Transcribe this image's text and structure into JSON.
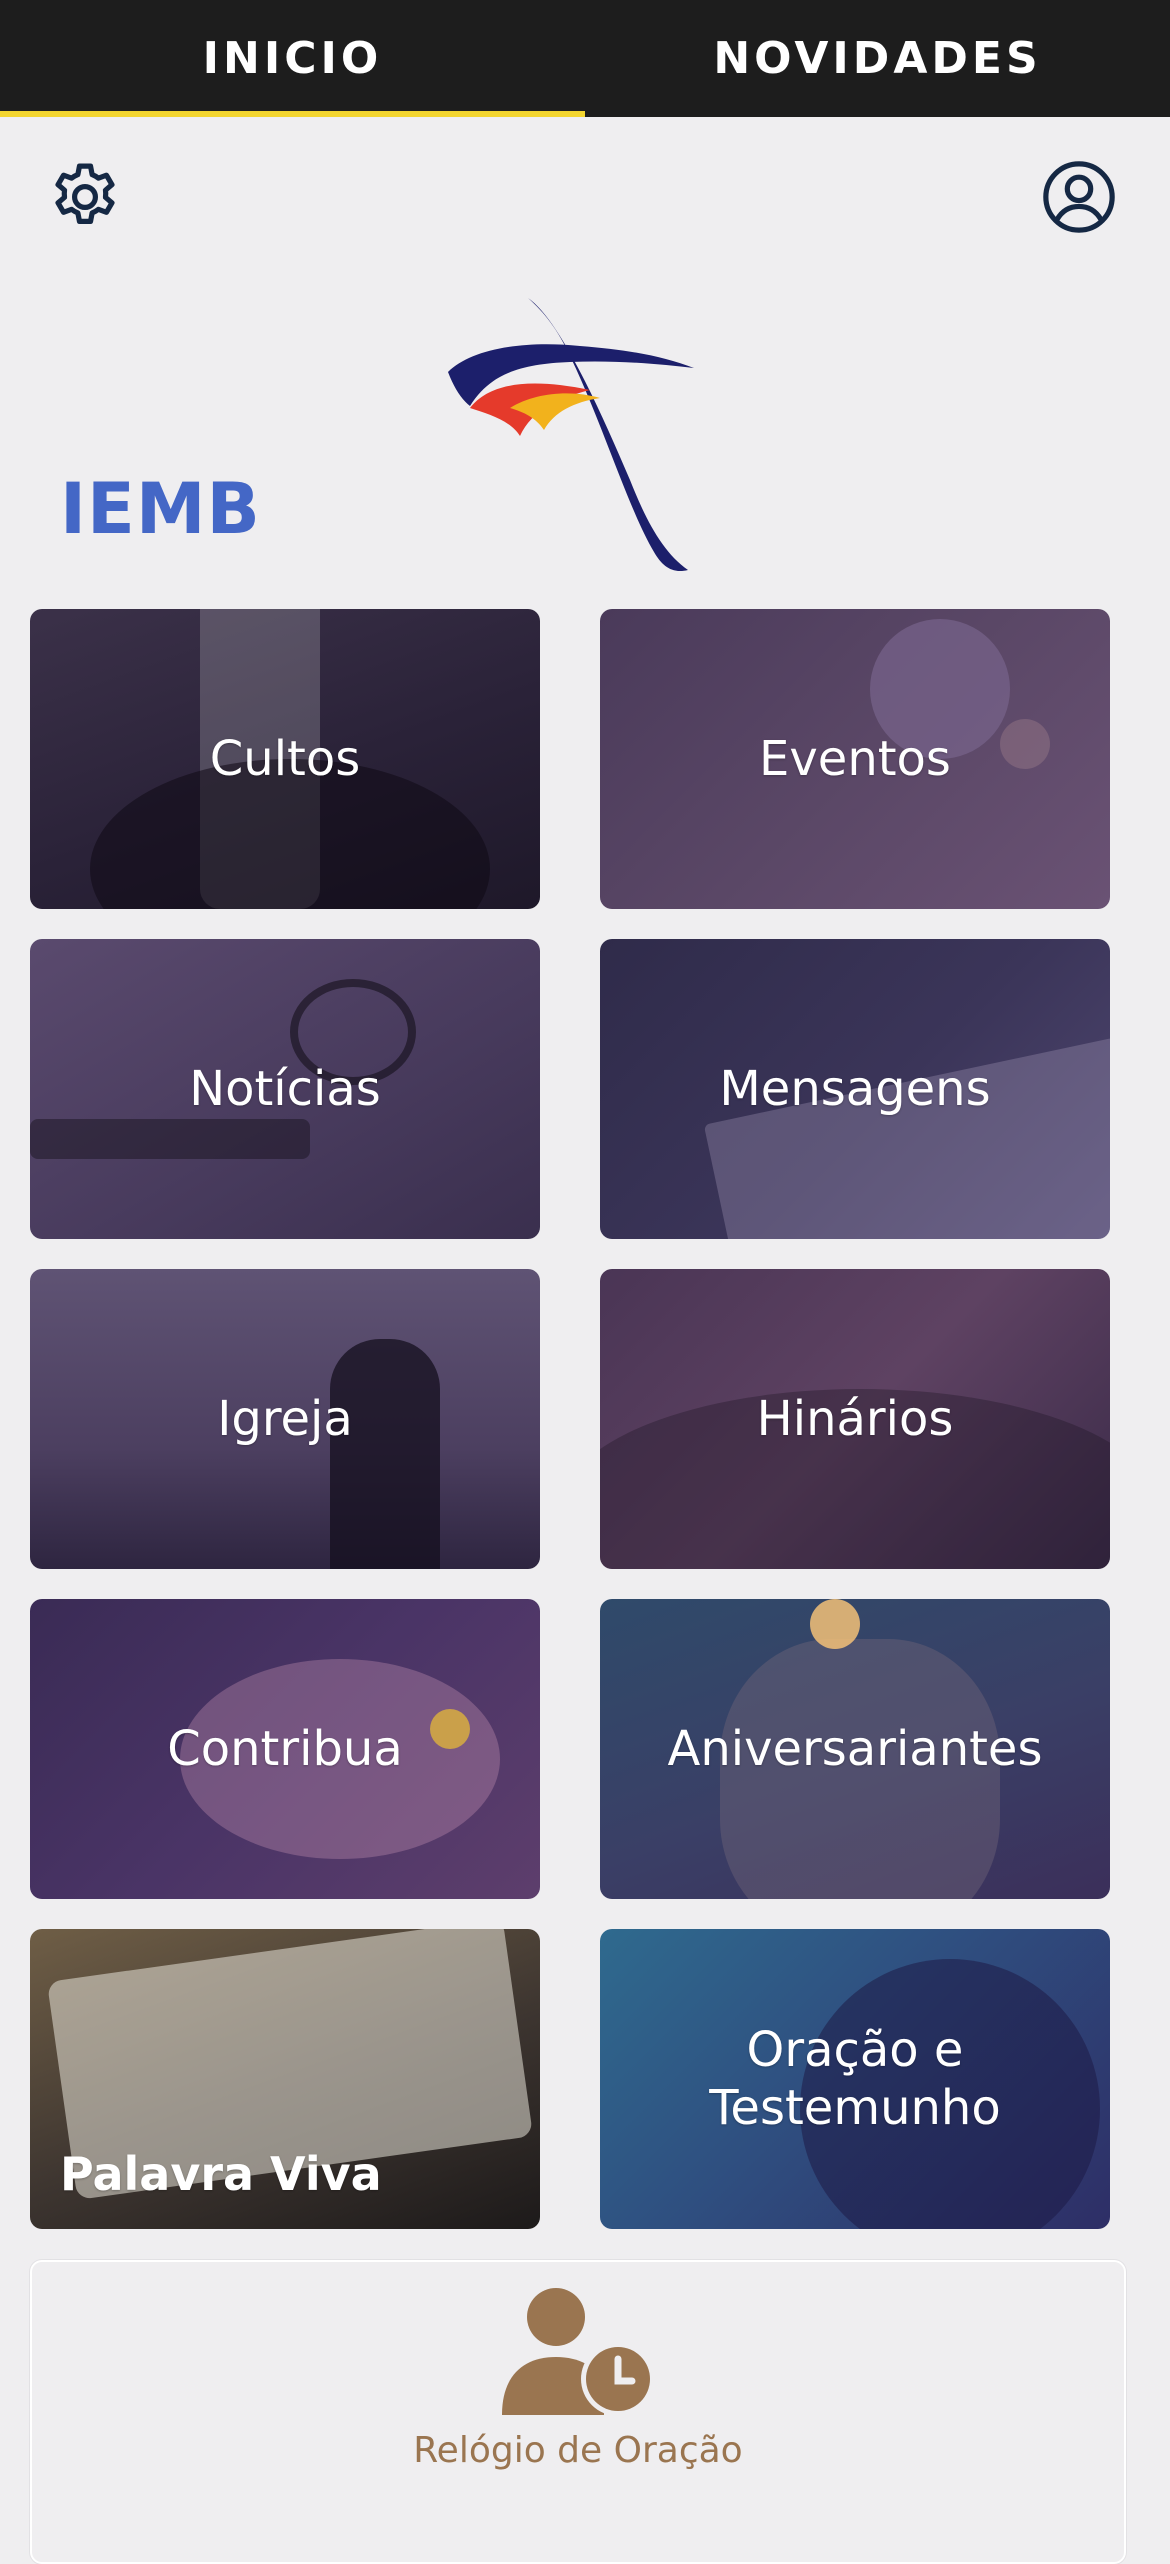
{
  "tabs": [
    {
      "label": "INICIO",
      "active": true
    },
    {
      "label": "NOVIDADES",
      "active": false
    }
  ],
  "header": {
    "settings_icon": "gear-icon",
    "profile_icon": "user-circle-icon"
  },
  "brand": {
    "name": "IEMB"
  },
  "tiles": [
    {
      "label": "Cultos"
    },
    {
      "label": "Eventos"
    },
    {
      "label": "Notícias"
    },
    {
      "label": "Mensagens"
    },
    {
      "label": "Igreja"
    },
    {
      "label": "Hinários"
    },
    {
      "label": "Contribua"
    },
    {
      "label": "Aniversariantes"
    },
    {
      "label": "Palavra Viva"
    },
    {
      "label": "Oração e Testemunho"
    }
  ],
  "prayer_clock": {
    "label": "Relógio de Oração",
    "icon": "user-clock-icon"
  },
  "colors": {
    "tab_bar": "#1d1d1d",
    "tab_indicator": "#f3d52f",
    "brand_blue": "#4467c6",
    "logo_navy": "#1c1f6b",
    "accent_brown": "#9a7550"
  }
}
